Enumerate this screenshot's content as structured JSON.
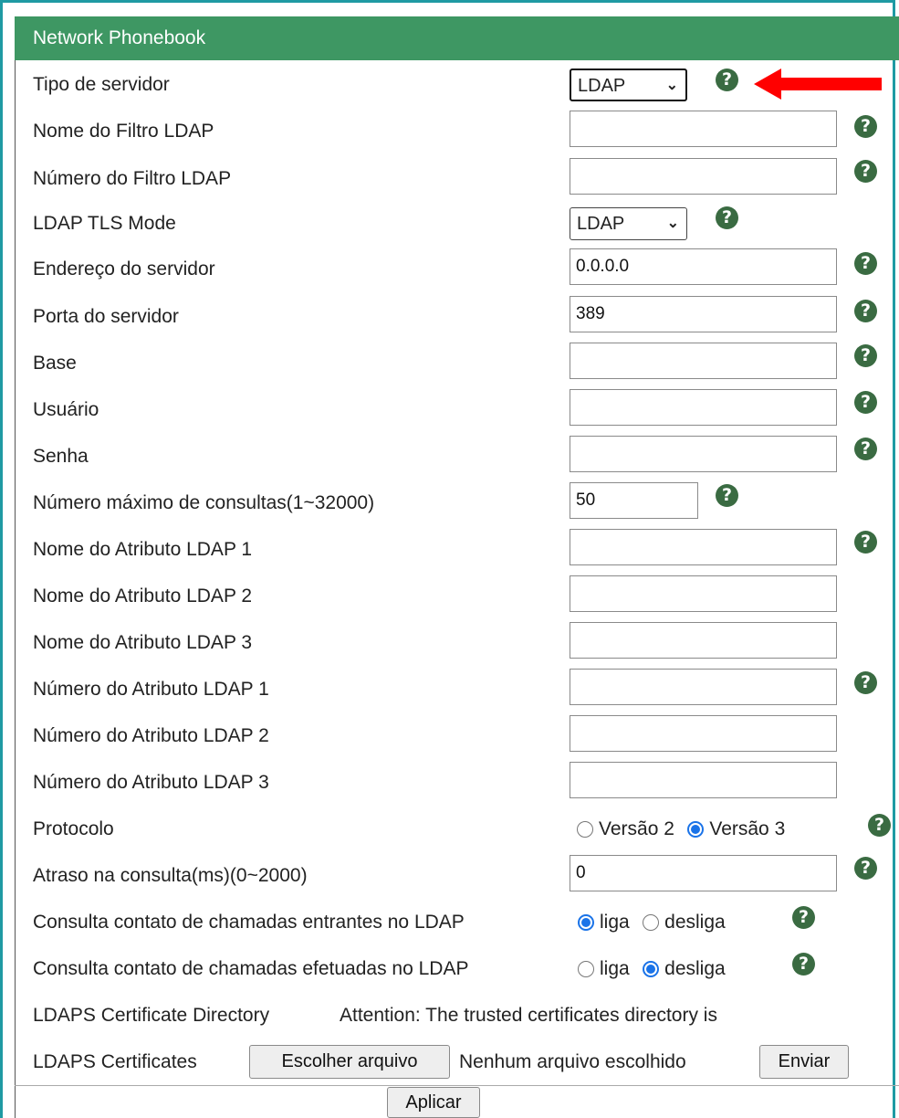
{
  "panel": {
    "title": "Network Phonebook"
  },
  "fields": [
    {
      "label": "Tipo de servidor",
      "type": "select",
      "value": "LDAP"
    },
    {
      "label": "Nome do Filtro LDAP",
      "type": "text",
      "value": ""
    },
    {
      "label": "Número do Filtro LDAP",
      "type": "text",
      "value": ""
    },
    {
      "label": "LDAP TLS Mode",
      "type": "select",
      "value": "LDAP"
    },
    {
      "label": "Endereço do servidor",
      "type": "text",
      "value": "0.0.0.0"
    },
    {
      "label": "Porta do servidor",
      "type": "text",
      "value": "389"
    },
    {
      "label": "Base",
      "type": "text",
      "value": ""
    },
    {
      "label": "Usuário",
      "type": "text",
      "value": ""
    },
    {
      "label": "Senha",
      "type": "text",
      "value": ""
    },
    {
      "label": "Número máximo de consultas(1~32000)",
      "type": "text",
      "value": "50"
    },
    {
      "label": "Nome do Atributo LDAP 1",
      "type": "text",
      "value": ""
    },
    {
      "label": "Nome do Atributo LDAP 2",
      "type": "text",
      "value": ""
    },
    {
      "label": "Nome do Atributo LDAP 3",
      "type": "text",
      "value": ""
    },
    {
      "label": "Número do Atributo LDAP 1",
      "type": "text",
      "value": ""
    },
    {
      "label": "Número do Atributo LDAP 2",
      "type": "text",
      "value": ""
    },
    {
      "label": "Número do Atributo LDAP 3",
      "type": "text",
      "value": ""
    },
    {
      "label": "Protocolo",
      "type": "radio",
      "options": [
        "Versão 2",
        "Versão 3"
      ],
      "selected": "Versão 3"
    },
    {
      "label": "Atraso na consulta(ms)(0~2000)",
      "type": "text",
      "value": "0"
    },
    {
      "label": "Consulta contato de chamadas entrantes no LDAP",
      "type": "radio",
      "options": [
        "liga",
        "desliga"
      ],
      "selected": "liga"
    },
    {
      "label": "Consulta contato de chamadas efetuadas no LDAP",
      "type": "radio",
      "options": [
        "liga",
        "desliga"
      ],
      "selected": "desliga"
    }
  ],
  "certificate_directory": {
    "label": "LDAPS Certificate Directory",
    "note": "Attention: The trusted certificates directory is"
  },
  "certificates": {
    "label": "LDAPS Certificates",
    "choose_button": "Escolher arquivo",
    "no_file_text": "Nenhum arquivo escolhido",
    "send_button": "Enviar"
  },
  "apply_button": "Aplicar",
  "help_icon_glyph": "?",
  "select_chevron": "⌄",
  "colors": {
    "header_bg": "#3e9763",
    "help_icon_bg": "#3a6b42",
    "frame_border": "#1f9aa3",
    "arrow": "#ff0000",
    "radio_selected": "#1a73e8"
  }
}
